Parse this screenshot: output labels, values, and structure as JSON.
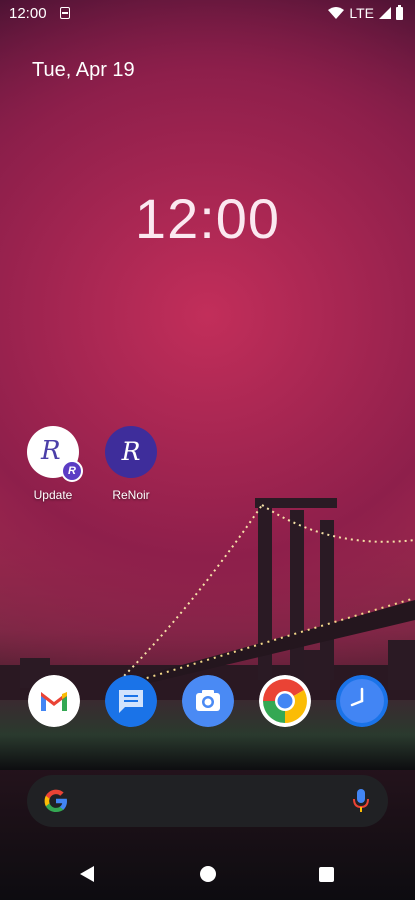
{
  "status_bar": {
    "time": "12:00",
    "network": "LTE",
    "icons": [
      "notification-icon",
      "wifi-icon",
      "signal-icon",
      "battery-icon"
    ]
  },
  "date_widget": {
    "text": "Tue, Apr 19"
  },
  "clock_widget": {
    "text": "12:00"
  },
  "apps": [
    {
      "name": "update",
      "label": "Update",
      "icon": "renoir-update-icon",
      "badge": "R"
    },
    {
      "name": "renoir",
      "label": "ReNoir",
      "icon": "renoir-icon"
    }
  ],
  "dock": [
    {
      "name": "gmail",
      "icon": "gmail-icon"
    },
    {
      "name": "messages",
      "icon": "messages-icon"
    },
    {
      "name": "camera",
      "icon": "camera-icon"
    },
    {
      "name": "chrome",
      "icon": "chrome-icon"
    },
    {
      "name": "clock",
      "icon": "clock-icon"
    }
  ],
  "search_bar": {
    "icons": [
      "google-g-icon",
      "microphone-icon"
    ]
  },
  "nav_bar": {
    "buttons": [
      "back",
      "home",
      "recents"
    ]
  },
  "colors": {
    "sky_top": "#3a0f2d",
    "sky_mid": "#b23352",
    "renoir_purple": "#3e2d9b",
    "search_bg": "#202124",
    "google_blue": "#4285f4",
    "google_red": "#ea4335",
    "google_yellow": "#fbbc05",
    "google_green": "#34a853"
  }
}
